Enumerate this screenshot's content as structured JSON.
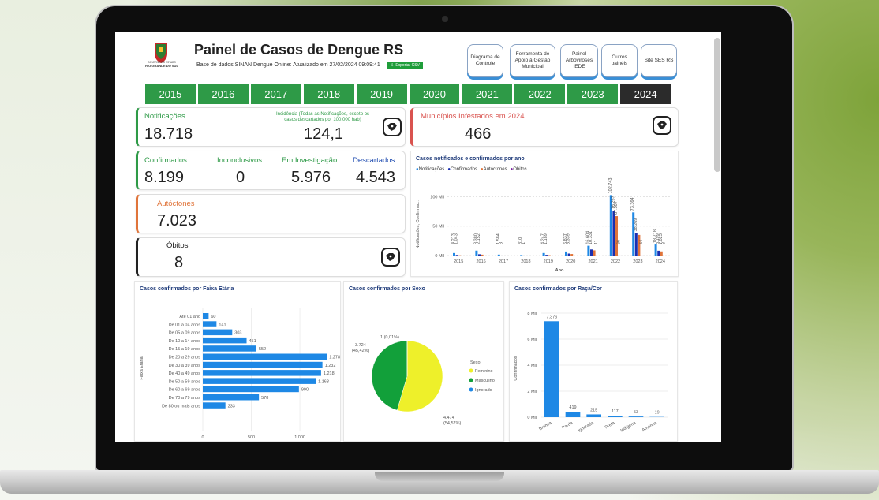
{
  "header": {
    "title": "Painel de Casos de Dengue RS",
    "subtitle": "Base de dados SINAN Dengue Online: Atualizado em 27/02/2024 09:09:41",
    "export_label": "Exportar CSV",
    "logo_text_1": "GOVERNO DO ESTADO",
    "logo_text_2": "RIO GRANDE DO SUL"
  },
  "nav": {
    "diagrama": "Diagrama de Controle",
    "ferramenta": "Ferramenta de Apoio à Gestão Municipal",
    "painel": "Painel Arboviroses IEDE",
    "outros": "Outros painéis",
    "site": "Site SES RS"
  },
  "years": [
    "2015",
    "2016",
    "2017",
    "2018",
    "2019",
    "2020",
    "2021",
    "2022",
    "2023",
    "2024"
  ],
  "active_year": "2024",
  "kpis": {
    "notificacoes_label": "Notificações",
    "notificacoes_value": "18.718",
    "incidencia_label": "Incidência (Todas as Notificações, exceto os casos descartados por 100.000 hab)",
    "incidencia_value": "124,1",
    "municipios_label": "Municípios Infestados em 2024",
    "municipios_value": "466",
    "confirmados_label": "Confirmados",
    "confirmados_value": "8.199",
    "inconclusivos_label": "Inconclusivos",
    "inconclusivos_value": "0",
    "investigacao_label": "Em Investigação",
    "investigacao_value": "5.976",
    "descartados_label": "Descartados",
    "descartados_value": "4.543",
    "autoctones_label": "Autóctones",
    "autoctones_value": "7.023",
    "obitos_label": "Óbitos",
    "obitos_value": "8"
  },
  "colors": {
    "green": "#2e9a47",
    "red": "#d9534f",
    "orange": "#e0743a",
    "blue": "#1e88e5",
    "navy": "#1a2fb0",
    "purple": "#7b1fa2",
    "yellow": "#eef02a"
  },
  "chart_data": [
    {
      "type": "bar",
      "title": "Casos notificados e confirmados por ano",
      "xlabel": "Ano",
      "ylabel": "Notificações, Confirmad...",
      "legend": [
        "Notificações",
        "Confirmados",
        "Autóctones",
        "Óbitos"
      ],
      "yticks": [
        "0 Mil",
        "50 Mil",
        "100 Mil"
      ],
      "ylim": [
        0,
        110000
      ],
      "categories": [
        "2015",
        "2016",
        "2017",
        "2018",
        "2019",
        "2020",
        "2021",
        "2022",
        "2023",
        "2024"
      ],
      "series": [
        {
          "name": "Notificações",
          "color": "#1e88e5",
          "values": [
            4213,
            8380,
            1584,
            810,
            4247,
            6837,
            16604,
            102743,
            73364,
            18718
          ],
          "labels": [
            "4.213",
            "8.380",
            "1.584",
            "810",
            "4.247",
            "6.837",
            "16.604",
            "102.743",
            "73.364",
            "18.718"
          ]
        },
        {
          "name": "Confirmados",
          "color": "#1a2fb0",
          "values": [
            1043,
            2152,
            3,
            1,
            1189,
            3339,
            10331,
            76267,
            38269,
            8199
          ],
          "labels": [
            "1.043",
            "2.152",
            "3",
            "1",
            "1.189",
            "3.339",
            "10.331",
            "76.267",
            "38.269",
            "8.199"
          ]
        },
        {
          "name": "Autóctones",
          "color": "#e0743a",
          "values": [
            400,
            1500,
            1,
            0,
            600,
            2600,
            8800,
            67000,
            35000,
            7023
          ],
          "labels": [
            "",
            "",
            "",
            "",
            "",
            "",
            "",
            "67.507",
            "",
            "7.023"
          ]
        },
        {
          "name": "Óbitos",
          "color": "#7b1fa2",
          "values": [
            0,
            0,
            0,
            0,
            0,
            0,
            11,
            66,
            54,
            8
          ],
          "labels": [
            "",
            "",
            "",
            "",
            "",
            "",
            "11",
            "66",
            "54",
            "8"
          ]
        }
      ]
    },
    {
      "type": "bar",
      "title": "Casos confirmados por Faixa Etária",
      "ylabel": "Faixa Etária",
      "xticks": [
        "0",
        "500",
        "1.000"
      ],
      "categories": [
        "Até 01 ano",
        "De 01 a 04 anos",
        "De 05 a 09 anos",
        "De 10 a 14 anos",
        "De 15 a 19 anos",
        "De 20 a 29 anos",
        "De 30 a 39 anos",
        "De 40 a 49 anos",
        "De 50 a 59 anos",
        "De 60 a 69 anos",
        "De 70 a 79 anos",
        "De 80 ou mais anos"
      ],
      "values": [
        60,
        141,
        303,
        451,
        552,
        1278,
        1232,
        1218,
        1163,
        990,
        578,
        233
      ],
      "labels": [
        "60",
        "141",
        "303",
        "451",
        "552",
        "1.278",
        "1.232",
        "1.218",
        "1.163",
        "990",
        "578",
        "233"
      ]
    },
    {
      "type": "pie",
      "title": "Casos confirmados por Sexo",
      "legend_title": "Sexo",
      "categories": [
        "Feminino",
        "Masculino",
        "Ignorado"
      ],
      "values": [
        4474,
        3724,
        1
      ],
      "labels": [
        "4.474\n(54,57%)",
        "3.724\n(45,42%)",
        "1 (0,01%)"
      ]
    },
    {
      "type": "bar",
      "title": "Casos confirmados por Raça/Cor",
      "ylabel": "Confirmados",
      "yticks": [
        "0 Mil",
        "2 Mil",
        "4 Mil",
        "6 Mil",
        "8 Mil"
      ],
      "ylim": [
        0,
        8000
      ],
      "categories": [
        "Branca",
        "Parda",
        "Ignorada",
        "Preta",
        "Indígena",
        "Amarela"
      ],
      "values": [
        7376,
        419,
        215,
        117,
        53,
        19
      ],
      "labels": [
        "7.376",
        "419",
        "215",
        "117",
        "53",
        "19"
      ]
    }
  ]
}
